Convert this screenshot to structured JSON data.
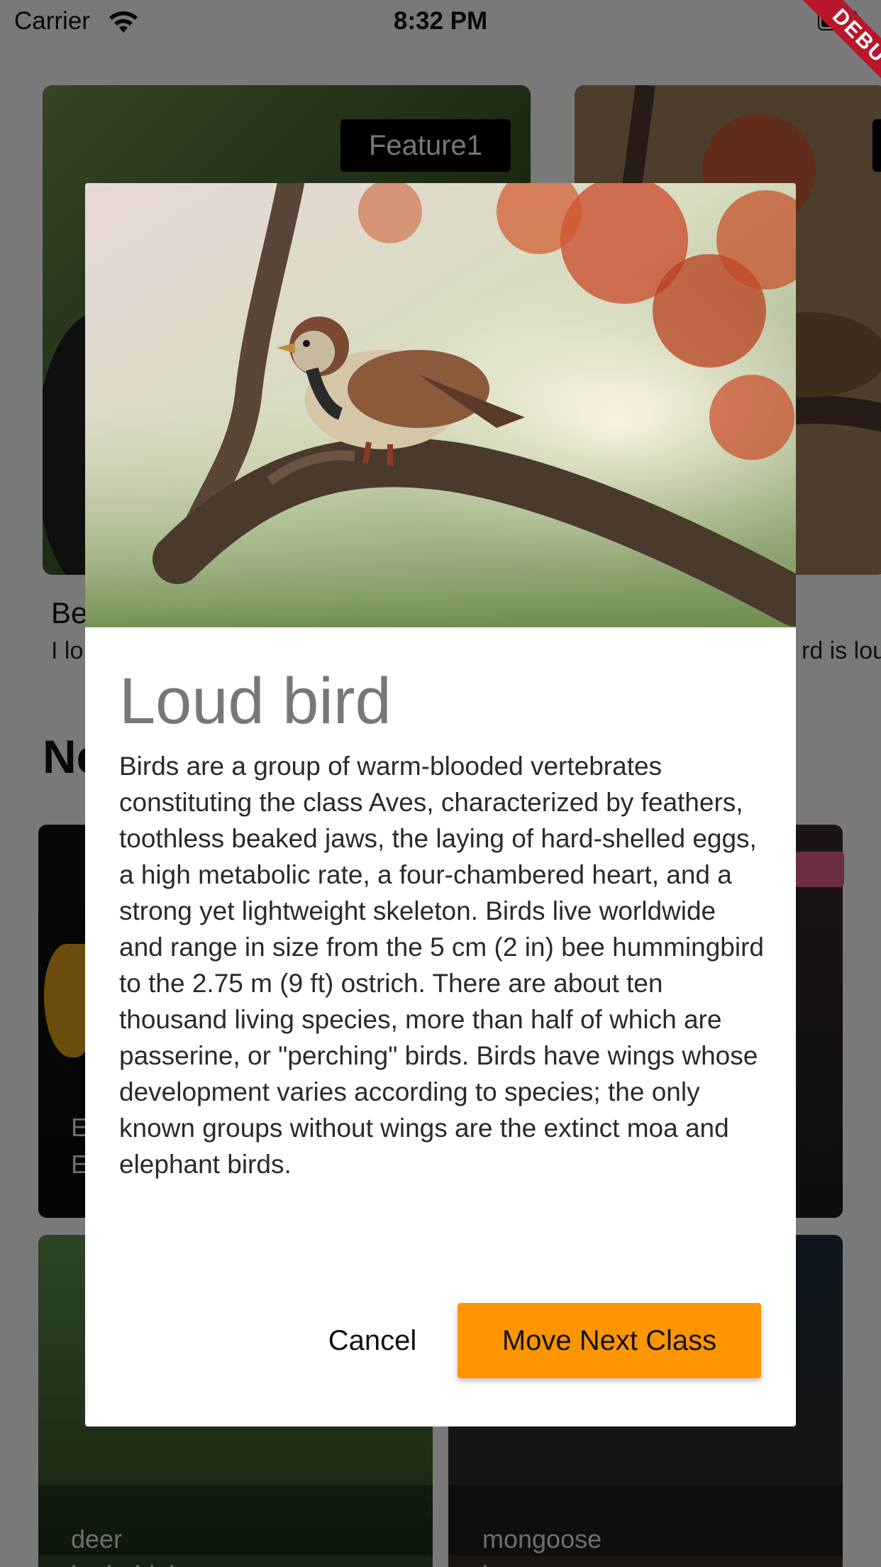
{
  "status_bar": {
    "carrier": "Carrier",
    "time": "8:32 PM"
  },
  "debug_banner": "DEBUG",
  "background": {
    "feature_badge": "Feature1",
    "feature_title_partial": "Be",
    "feature_subtitle_partial": "I lo",
    "second_card_subtitle_partial": "rd is lou",
    "section_title_partial": "Ne",
    "grid": [
      {
        "line1": "E",
        "line2": "E"
      },
      {
        "line1": "",
        "line2": ""
      },
      {
        "line1": "deer",
        "line2": "hydorhiphy"
      },
      {
        "line1": "mongoose",
        "line2": "h"
      }
    ]
  },
  "dialog": {
    "image_name": "sparrow-on-branch",
    "title": "Loud bird",
    "body": "Birds are a group of warm-blooded vertebrates constituting the class Aves, characterized by feathers, toothless beaked jaws, the laying of hard-shelled eggs, a high metabolic rate, a four-chambered heart, and a strong yet lightweight skeleton. Birds live worldwide and range in size from the 5 cm (2 in) bee hummingbird to the 2.75 m (9 ft) ostrich. There are about ten thousand living species, more than half of which are passerine, or \"perching\" birds. Birds have wings whose development varies according to species; the only known groups without wings are the extinct moa and elephant birds.",
    "cancel_label": "Cancel",
    "next_label": "Move Next Class"
  },
  "colors": {
    "accent": "#ff9500",
    "scrim": "rgba(0,0,0,0.5)",
    "debug": "#b8162a"
  }
}
